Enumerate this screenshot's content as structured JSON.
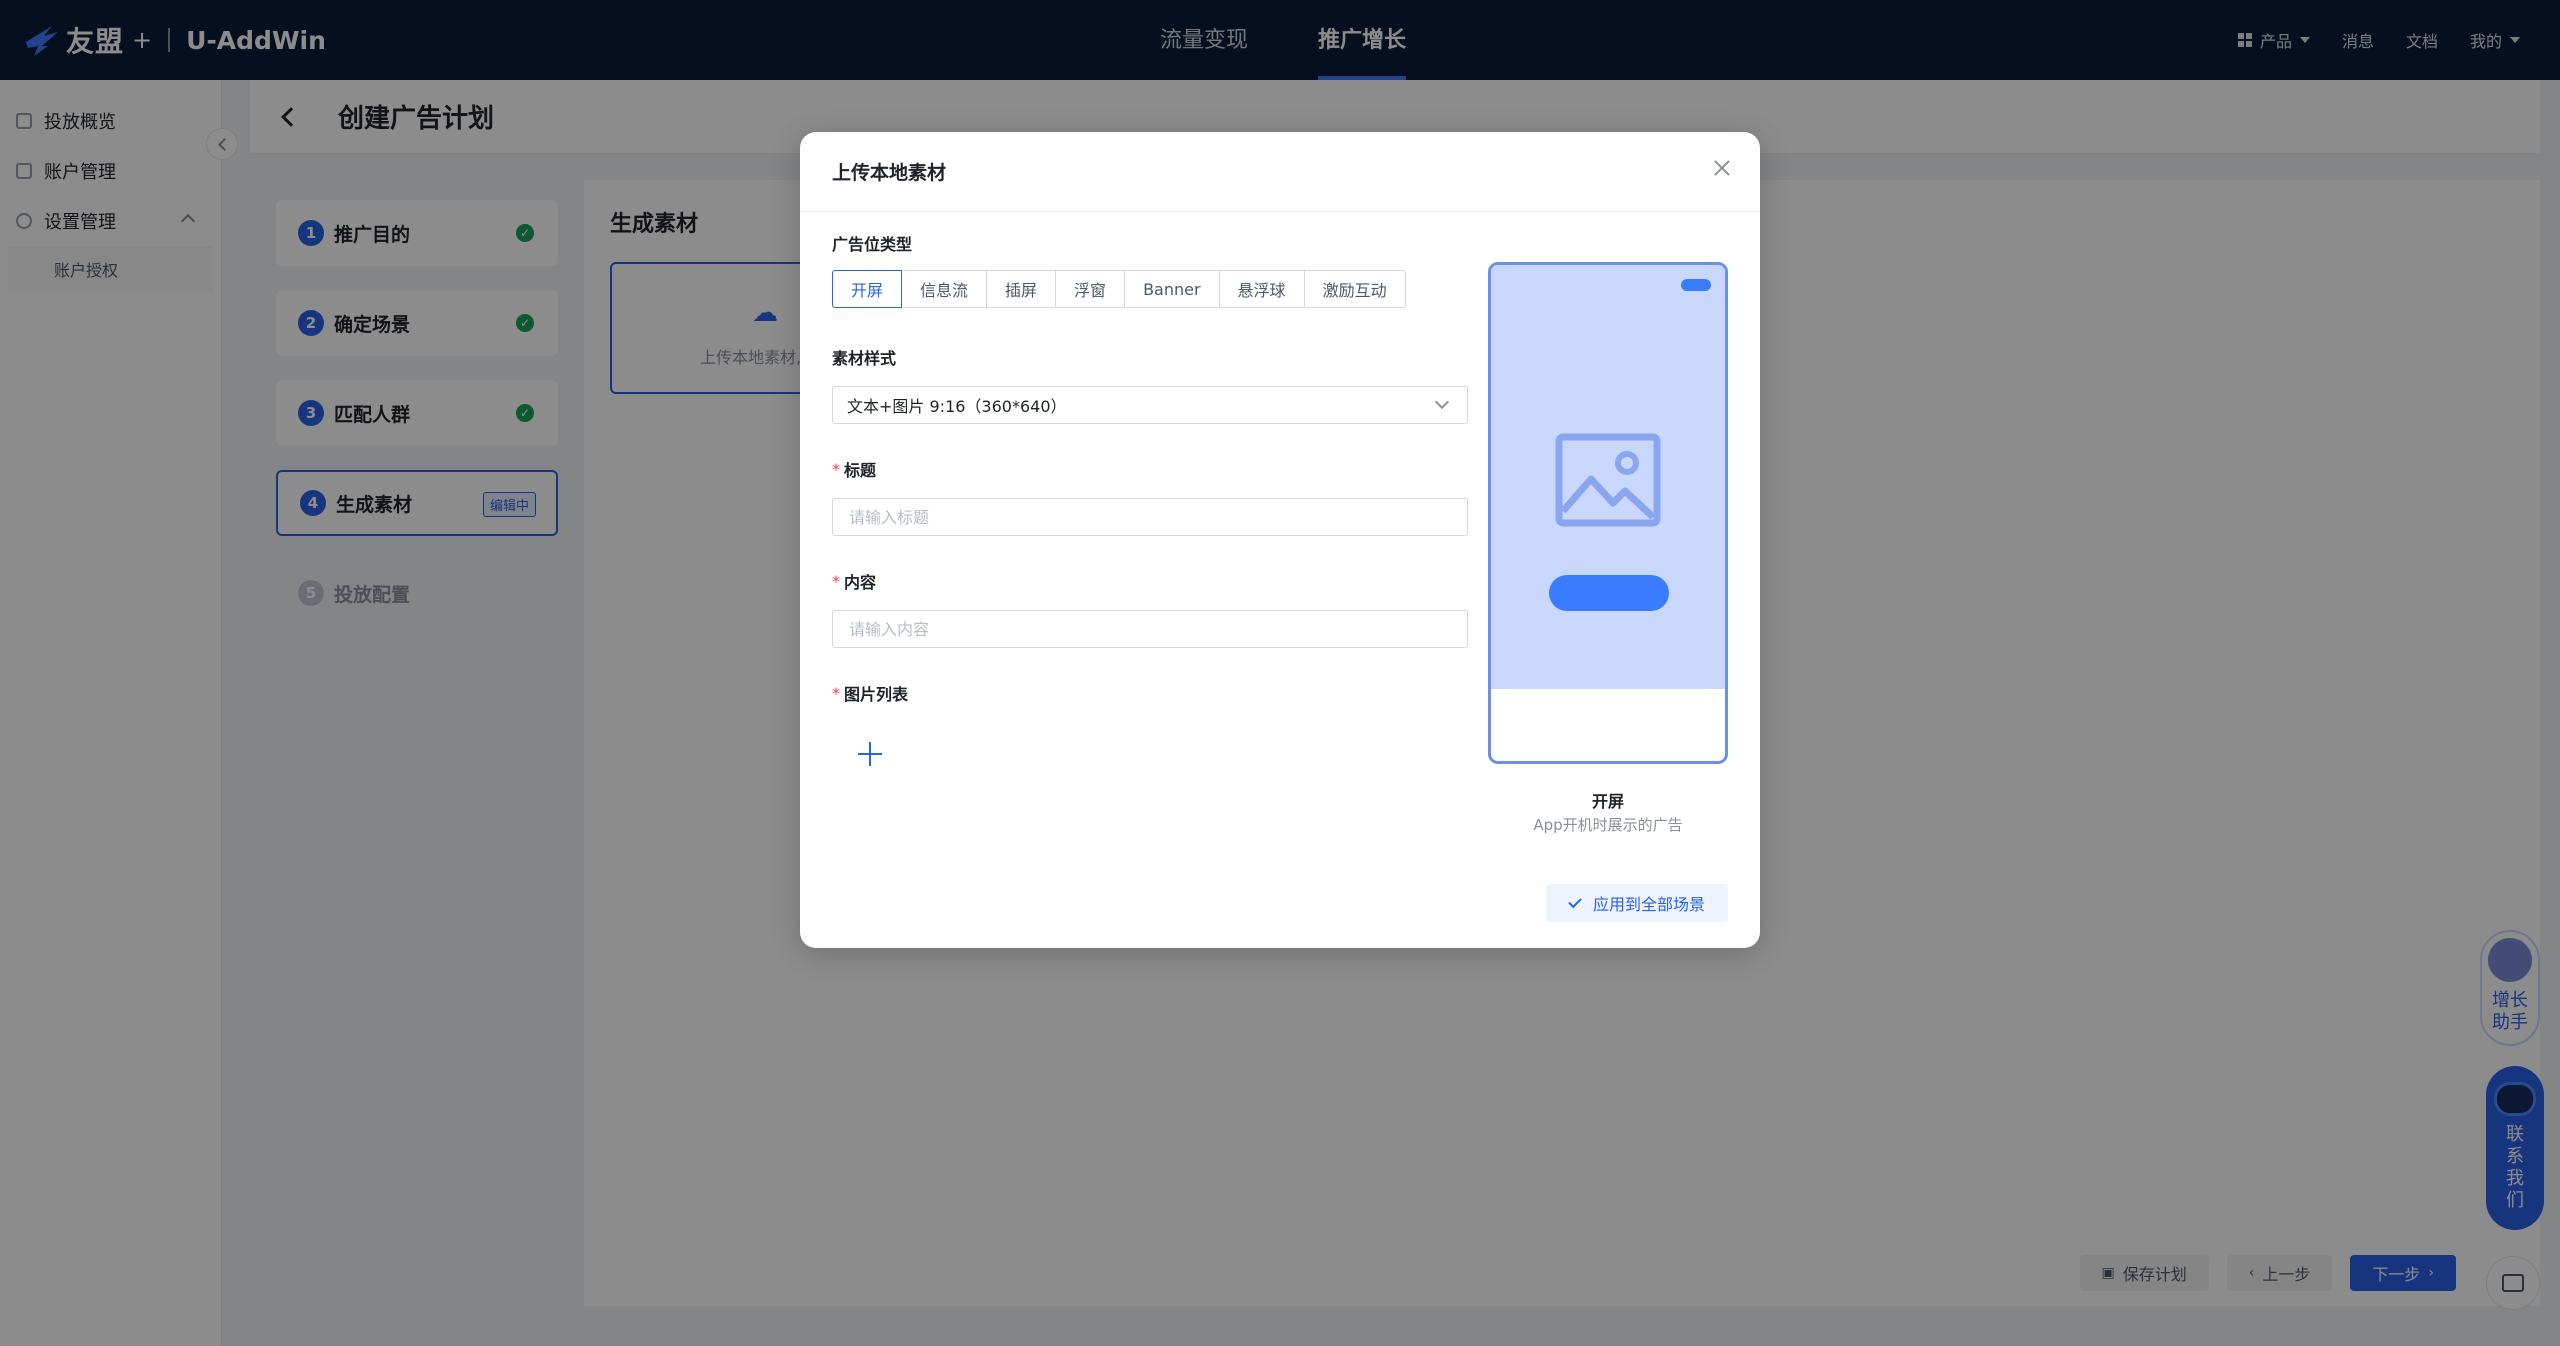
{
  "brand": {
    "name": "友盟",
    "plus": "+",
    "product": "U-AddWin"
  },
  "nav": {
    "tabs": [
      {
        "label": "流量变现"
      },
      {
        "label": "推广增长"
      }
    ],
    "right": {
      "product": "产品",
      "messages": "消息",
      "docs": "文档",
      "mine": "我的"
    }
  },
  "sidebar": {
    "items": [
      {
        "label": "投放概览"
      },
      {
        "label": "账户管理"
      },
      {
        "label": "设置管理"
      }
    ],
    "sub_items": [
      {
        "label": "账户授权"
      }
    ]
  },
  "page": {
    "title": "创建广告计划"
  },
  "steps": [
    {
      "num": "1",
      "label": "推广目的",
      "status": "done"
    },
    {
      "num": "2",
      "label": "确定场景",
      "status": "done"
    },
    {
      "num": "3",
      "label": "匹配人群",
      "status": "done"
    },
    {
      "num": "4",
      "label": "生成素材",
      "status": "current",
      "badge": "编辑中"
    },
    {
      "num": "5",
      "label": "投放配置",
      "status": "disabled"
    }
  ],
  "content": {
    "title": "生成素材",
    "upload_card_text": "上传本地素材,"
  },
  "footer": {
    "save": "保存计划",
    "prev": "上一步",
    "next": "下一步"
  },
  "floats": {
    "growth": "增长助手",
    "contact": "联系我们"
  },
  "modal": {
    "title": "上传本地素材",
    "ad_type_label": "广告位类型",
    "ad_types": [
      "开屏",
      "信息流",
      "插屏",
      "浮窗",
      "Banner",
      "悬浮球",
      "激励互动"
    ],
    "selected_ad_type": "开屏",
    "style_label": "素材样式",
    "style_value": "文本+图片 9:16（360*640）",
    "title_label": "标题",
    "title_placeholder": "请输入标题",
    "content_label": "内容",
    "content_placeholder": "请输入内容",
    "images_label": "图片列表",
    "preview_name": "开屏",
    "preview_desc": "App开机时展示的广告",
    "apply_label": "应用到全部场景",
    "required_mark": "*"
  },
  "colors": {
    "primary": "#2a62e8",
    "nav_bg": "#0c1c3a",
    "success": "#19a35a",
    "required": "#f53f3f"
  }
}
